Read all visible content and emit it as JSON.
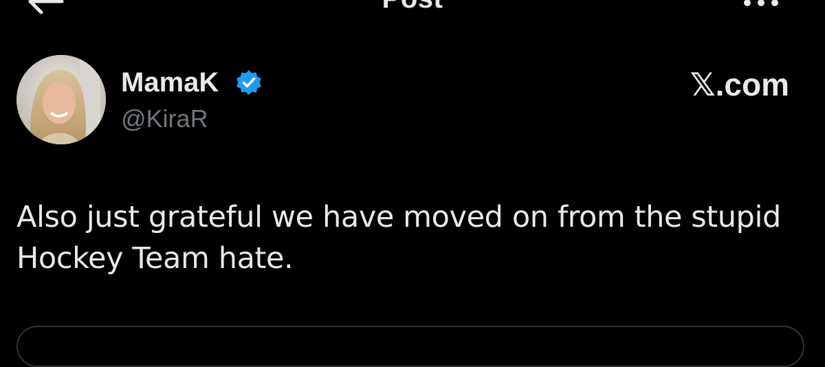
{
  "header": {
    "title": "Post",
    "back_icon": "arrow-left-icon",
    "more_icon": "more-horizontal-icon"
  },
  "author": {
    "display_name": "MamaK",
    "handle": "@KiraR",
    "verified": true,
    "verified_color": "#1d9bf0"
  },
  "brand": {
    "label": "𝕏.com"
  },
  "post": {
    "text": "Also just grateful we have moved on from the stupid Hockey Team hate."
  },
  "colors": {
    "background": "#000000",
    "text_primary": "#e7e9ea",
    "text_secondary": "#71767b",
    "border": "#2f3336"
  }
}
